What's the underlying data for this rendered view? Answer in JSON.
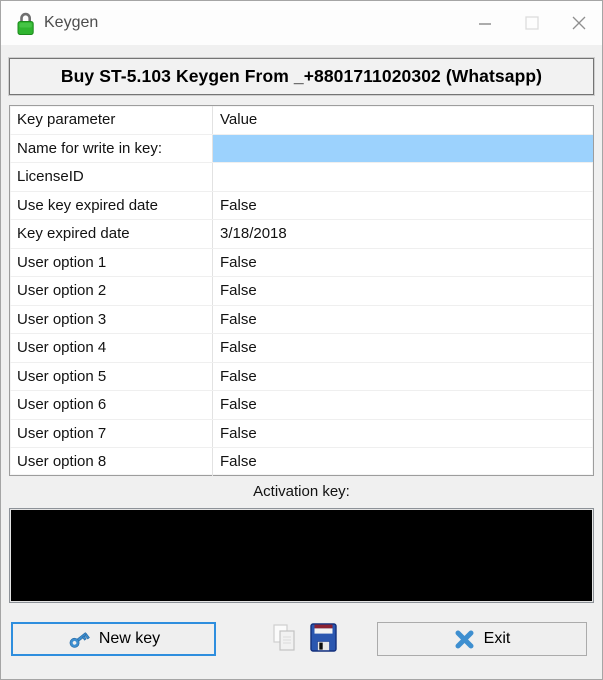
{
  "window": {
    "title": "Keygen"
  },
  "header": {
    "label": "Buy ST-5.103 Keygen From _+8801711020302 (Whatsapp)"
  },
  "table": {
    "columns": [
      "Key parameter",
      "Value"
    ],
    "rows": [
      {
        "param": "Name for write in key:",
        "value": "",
        "selected": true
      },
      {
        "param": "LicenseID",
        "value": ""
      },
      {
        "param": "Use key expired date",
        "value": "False"
      },
      {
        "param": "Key expired date",
        "value": "3/18/2018"
      },
      {
        "param": "User option 1",
        "value": "False"
      },
      {
        "param": "User option 2",
        "value": "False"
      },
      {
        "param": "User option 3",
        "value": "False"
      },
      {
        "param": "User option 4",
        "value": "False"
      },
      {
        "param": "User option 5",
        "value": "False"
      },
      {
        "param": "User option 6",
        "value": "False"
      },
      {
        "param": "User option 7",
        "value": "False"
      },
      {
        "param": "User option 8",
        "value": "False"
      }
    ]
  },
  "activation": {
    "label": "Activation key:",
    "value": ""
  },
  "buttons": {
    "new_key": "New key",
    "exit": "Exit"
  },
  "icons": {
    "titlebar": "green-lock-icon",
    "new_key": "key-icon",
    "copy": "copy-icon",
    "save": "floppy-save-icon",
    "exit": "x-icon"
  },
  "colors": {
    "selection_blue": "#9cd2fd",
    "accent_blue": "#3e8fd0",
    "focus_border": "#2e8ede",
    "lock_green": "#2fb52f",
    "floppy_blue": "#2b57b0",
    "floppy_red": "#8c2333",
    "textarea_black": "#000000"
  }
}
